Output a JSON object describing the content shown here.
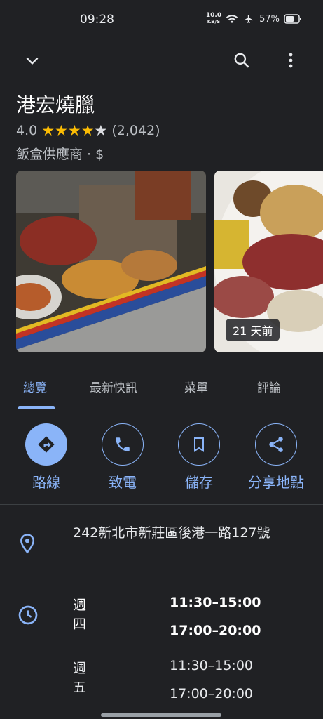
{
  "status": {
    "time": "09:28",
    "net_speed": "10.0",
    "net_unit": "KB/S",
    "battery": "57%"
  },
  "place": {
    "name": "港宏燒臘",
    "rating": "4.0",
    "review_count": "(2,042)",
    "category": "飯盒供應商 · $",
    "photo_badge": "21 天前"
  },
  "tabs": [
    {
      "label": "總覽"
    },
    {
      "label": "最新快訊"
    },
    {
      "label": "菜單"
    },
    {
      "label": "評論"
    }
  ],
  "actions": [
    {
      "label": "路線"
    },
    {
      "label": "致電"
    },
    {
      "label": "儲存"
    },
    {
      "label": "分享地點"
    }
  ],
  "address": "242新北市新莊區後港一路127號",
  "hours": [
    {
      "day": "週四",
      "slot1": "11:30–15:00",
      "slot2": "17:00–20:00"
    },
    {
      "day": "週五",
      "slot1": "11:30–15:00",
      "slot2": "17:00–20:00"
    }
  ],
  "colors": {
    "accent": "#8ab4f8",
    "star": "#fbbc04",
    "background": "#202124"
  }
}
